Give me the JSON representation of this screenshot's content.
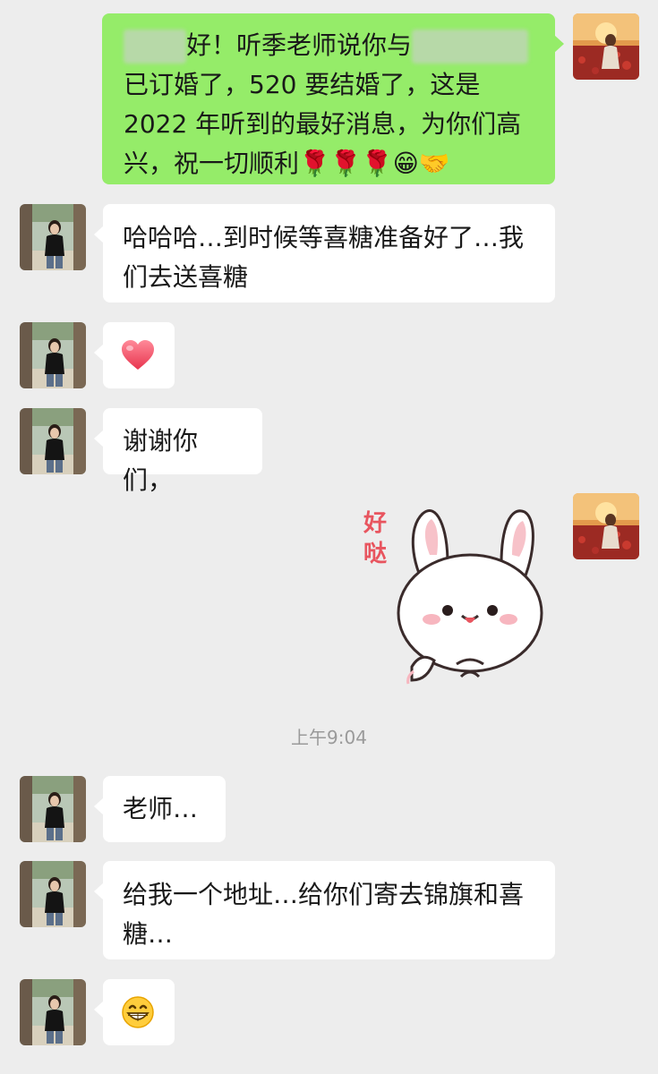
{
  "messages": [
    {
      "id": "m1",
      "side": "out",
      "type": "text",
      "part1": "好！听季老师说你与",
      "part2": "已订婚了，520 要结婚了，这是 2022 年听到的最好消息，为你们高兴，祝一切顺利",
      "emoji": "🌹🌹🌹😁🤝"
    },
    {
      "id": "m2",
      "side": "in",
      "type": "text",
      "text": "哈哈哈…到时候等喜糖准备好了…我们去送喜糖"
    },
    {
      "id": "m3",
      "side": "in",
      "type": "emoji",
      "icon": "heart-icon"
    },
    {
      "id": "m4",
      "side": "in",
      "type": "text",
      "text": "谢谢你们，"
    },
    {
      "id": "m5",
      "side": "out",
      "type": "sticker",
      "sticker_text": "好哒",
      "icon": "bunny-sticker"
    },
    {
      "id": "m6",
      "side": "in",
      "type": "text",
      "text": "老师…"
    },
    {
      "id": "m7",
      "side": "in",
      "type": "text",
      "text": "给我一个地址…给你们寄去锦旗和喜糖…"
    },
    {
      "id": "m8",
      "side": "in",
      "type": "emoji",
      "icon": "grinning-face-icon"
    }
  ],
  "timestamp": "上午9:04",
  "colors": {
    "background": "#ededed",
    "outgoing_bubble": "#95ec69",
    "incoming_bubble": "#ffffff",
    "timestamp": "#9a9a9a"
  }
}
